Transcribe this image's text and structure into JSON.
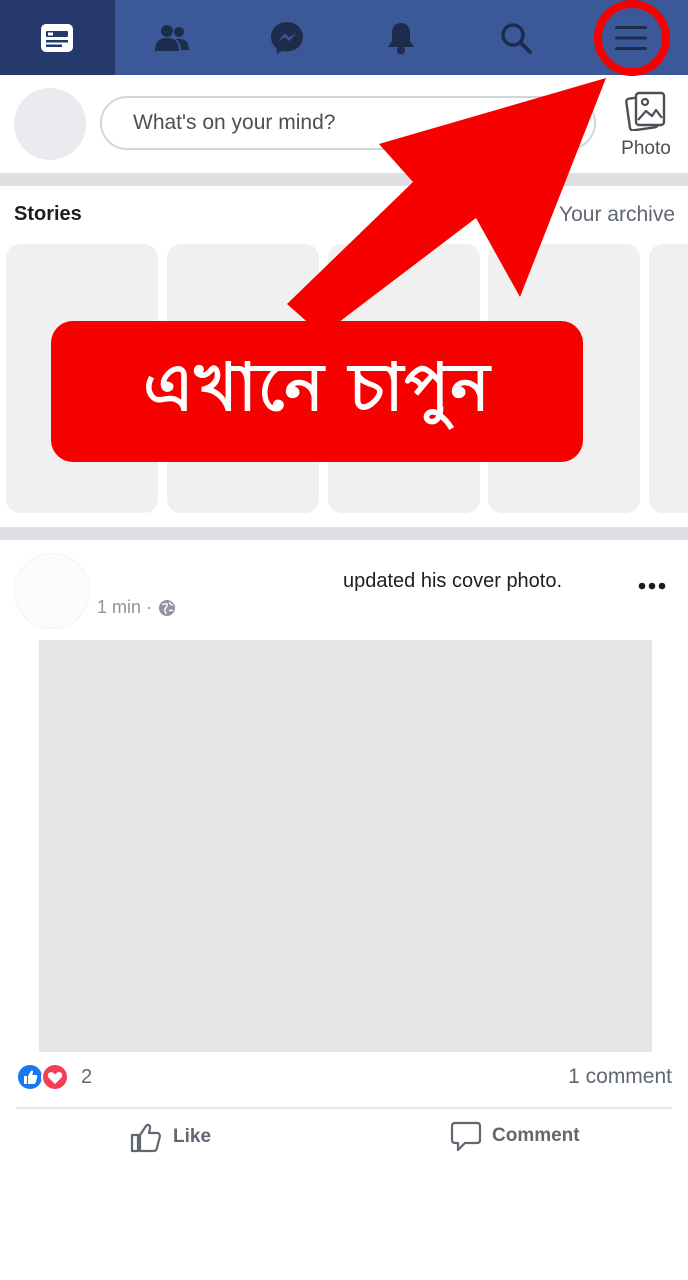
{
  "nav": {
    "tabs": [
      {
        "name": "news-feed",
        "icon": "news-feed-icon",
        "active": true
      },
      {
        "name": "friends",
        "icon": "friends-icon"
      },
      {
        "name": "messenger",
        "icon": "messenger-icon"
      },
      {
        "name": "notifications",
        "icon": "bell-icon"
      },
      {
        "name": "search",
        "icon": "search-icon"
      },
      {
        "name": "menu",
        "icon": "hamburger-menu-icon",
        "highlighted": true
      }
    ],
    "bar_color": "#3b5998",
    "active_color": "#24386b"
  },
  "composer": {
    "placeholder": "What's on your mind?",
    "photo_label": "Photo",
    "photo_icon": "photo-gallery-icon"
  },
  "stories": {
    "title": "Stories",
    "archive_label": "Your archive",
    "card_count": 5
  },
  "post": {
    "action_text": "updated his cover photo.",
    "time": "1 min ·",
    "privacy_icon": "globe-icon",
    "more_icon": "more-dots-icon",
    "reaction_icons": [
      "like-reaction-icon",
      "love-reaction-icon"
    ],
    "reaction_count": "2",
    "comment_count": "1 comment",
    "like_label": "Like",
    "comment_label": "Comment"
  },
  "annotation": {
    "callout_text": "এখানে চাপুন",
    "color": "#f70000",
    "target": "hamburger-menu-icon"
  }
}
